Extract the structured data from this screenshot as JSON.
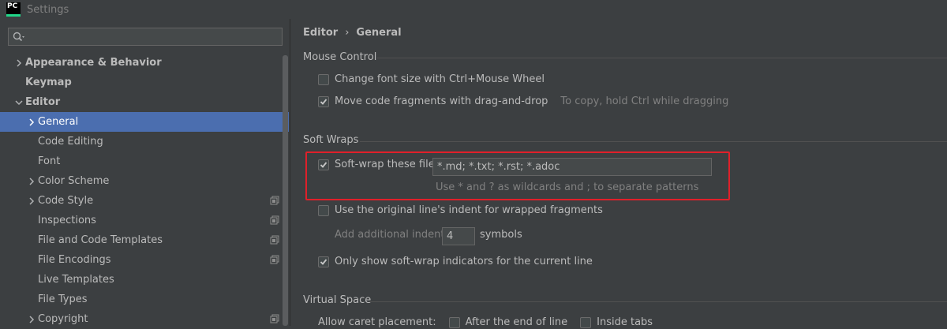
{
  "window": {
    "title": "Settings",
    "logo_text": "PC"
  },
  "search": {
    "placeholder": ""
  },
  "tree": {
    "items": [
      {
        "label": "Appearance & Behavior",
        "level": 0,
        "expander": "collapsed",
        "bold": true,
        "selected": false,
        "project_icon": false
      },
      {
        "label": "Keymap",
        "level": 0,
        "expander": "none",
        "bold": true,
        "selected": false,
        "project_icon": false
      },
      {
        "label": "Editor",
        "level": 0,
        "expander": "expanded",
        "bold": true,
        "selected": false,
        "project_icon": false
      },
      {
        "label": "General",
        "level": 1,
        "expander": "collapsed",
        "bold": false,
        "selected": true,
        "project_icon": false
      },
      {
        "label": "Code Editing",
        "level": 1,
        "expander": "none",
        "bold": false,
        "selected": false,
        "project_icon": false
      },
      {
        "label": "Font",
        "level": 1,
        "expander": "none",
        "bold": false,
        "selected": false,
        "project_icon": false
      },
      {
        "label": "Color Scheme",
        "level": 1,
        "expander": "collapsed",
        "bold": false,
        "selected": false,
        "project_icon": false
      },
      {
        "label": "Code Style",
        "level": 1,
        "expander": "collapsed",
        "bold": false,
        "selected": false,
        "project_icon": true
      },
      {
        "label": "Inspections",
        "level": 1,
        "expander": "none",
        "bold": false,
        "selected": false,
        "project_icon": true
      },
      {
        "label": "File and Code Templates",
        "level": 1,
        "expander": "none",
        "bold": false,
        "selected": false,
        "project_icon": true
      },
      {
        "label": "File Encodings",
        "level": 1,
        "expander": "none",
        "bold": false,
        "selected": false,
        "project_icon": true
      },
      {
        "label": "Live Templates",
        "level": 1,
        "expander": "none",
        "bold": false,
        "selected": false,
        "project_icon": false
      },
      {
        "label": "File Types",
        "level": 1,
        "expander": "none",
        "bold": false,
        "selected": false,
        "project_icon": false
      },
      {
        "label": "Copyright",
        "level": 1,
        "expander": "collapsed",
        "bold": false,
        "selected": false,
        "project_icon": true
      }
    ]
  },
  "breadcrumb": {
    "parent": "Editor",
    "separator": "›",
    "current": "General"
  },
  "mouse_control": {
    "title": "Mouse Control",
    "change_font_size": {
      "label": "Change font size with Ctrl+Mouse Wheel",
      "checked": false
    },
    "drag_drop": {
      "label": "Move code fragments with drag-and-drop",
      "checked": true,
      "hint": "To copy, hold Ctrl while dragging"
    }
  },
  "soft_wraps": {
    "title": "Soft Wraps",
    "soft_wrap_files": {
      "label": "Soft-wrap these files:",
      "checked": true,
      "value": "*.md; *.txt; *.rst; *.adoc",
      "hint": "Use * and ? as wildcards and ; to separate patterns"
    },
    "original_indent": {
      "label": "Use the original line's indent for wrapped fragments",
      "checked": false
    },
    "additional_indent": {
      "label": "Add additional indent:",
      "value": "4",
      "suffix": "symbols"
    },
    "indicators": {
      "label": "Only show soft-wrap indicators for the current line",
      "checked": true
    }
  },
  "virtual_space": {
    "title": "Virtual Space",
    "caret_placement": {
      "label": "Allow caret placement:"
    },
    "after_end": {
      "label": "After the end of line",
      "checked": false
    },
    "inside_tabs": {
      "label": "Inside tabs",
      "checked": false
    }
  },
  "colors": {
    "selection": "#4b6eaf",
    "highlight_border": "#e0202a",
    "background": "#3c3f41"
  }
}
